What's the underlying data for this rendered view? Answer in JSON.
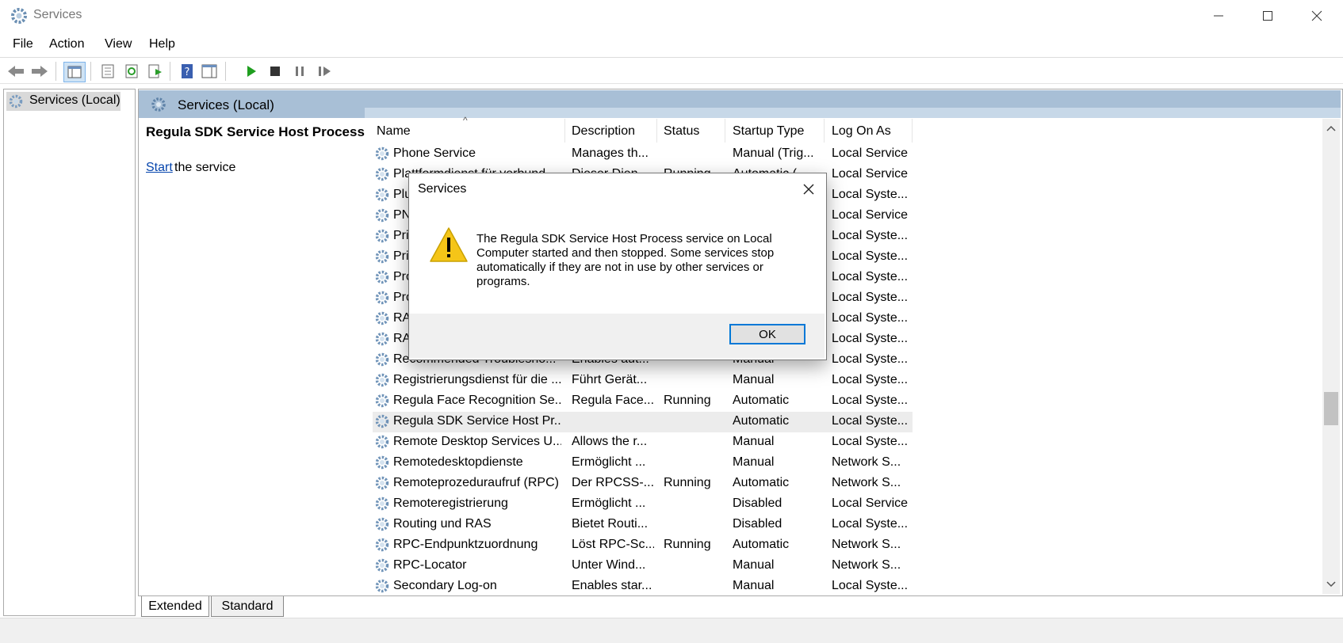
{
  "window": {
    "title": "Services"
  },
  "menu": [
    "File",
    "Action",
    "View",
    "Help"
  ],
  "tree": {
    "root": "Services (Local)"
  },
  "panel": {
    "header": "Services (Local)",
    "selected_service": "Regula SDK Service Host Process",
    "start_link": "Start",
    "start_rest": "the service"
  },
  "columns": {
    "name": "Name",
    "description": "Description",
    "status": "Status",
    "startup": "Startup Type",
    "logon": "Log On As"
  },
  "sort_indicator": "^",
  "rows": [
    {
      "name": "Phone Service",
      "desc": "Manages th...",
      "status": "",
      "startup": "Manual (Trig...",
      "logon": "Local Service"
    },
    {
      "name": "Plattformdienst für verbund...",
      "desc": "Dieser Dien...",
      "status": "Running",
      "startup": "Automatic (...",
      "logon": "Local Service"
    },
    {
      "name": "Plug and Play",
      "desc": "",
      "status": "",
      "startup": "",
      "logon": "Local Syste..."
    },
    {
      "name": "PNRP",
      "desc": "",
      "status": "",
      "startup": "",
      "logon": "Local Service"
    },
    {
      "name": "Print",
      "desc": "",
      "status": "",
      "startup": "",
      "logon": "Local Syste..."
    },
    {
      "name": "Print",
      "desc": "",
      "status": "",
      "startup": "",
      "logon": "Local Syste..."
    },
    {
      "name": "Prog",
      "desc": "",
      "status": "",
      "startup": "",
      "logon": "Local Syste..."
    },
    {
      "name": "Prog",
      "desc": "",
      "status": "",
      "startup": "",
      "logon": "Local Syste..."
    },
    {
      "name": "RAS",
      "desc": "",
      "status": "",
      "startup": "",
      "logon": "Local Syste..."
    },
    {
      "name": "RAS",
      "desc": "",
      "status": "",
      "startup": "",
      "logon": "Local Syste..."
    },
    {
      "name": "Recommended Troublesho...",
      "desc": "Enables aut...",
      "status": "",
      "startup": "Manual",
      "logon": "Local Syste..."
    },
    {
      "name": "Registrierungsdienst für die ...",
      "desc": "Führt Gerät...",
      "status": "",
      "startup": "Manual",
      "logon": "Local Syste..."
    },
    {
      "name": "Regula Face Recognition Se...",
      "desc": "Regula Face...",
      "status": "Running",
      "startup": "Automatic",
      "logon": "Local Syste..."
    },
    {
      "name": "Regula SDK Service Host Pr...",
      "desc": "",
      "status": "",
      "startup": "Automatic",
      "logon": "Local Syste..."
    },
    {
      "name": "Remote Desktop Services U...",
      "desc": "Allows the r...",
      "status": "",
      "startup": "Manual",
      "logon": "Local Syste..."
    },
    {
      "name": "Remotedesktopdienste",
      "desc": "Ermöglicht ...",
      "status": "",
      "startup": "Manual",
      "logon": "Network S..."
    },
    {
      "name": "Remoteprozeduraufruf (RPC)",
      "desc": "Der RPCSS-...",
      "status": "Running",
      "startup": "Automatic",
      "logon": "Network S..."
    },
    {
      "name": "Remoteregistrierung",
      "desc": "Ermöglicht ...",
      "status": "",
      "startup": "Disabled",
      "logon": "Local Service"
    },
    {
      "name": "Routing und RAS",
      "desc": "Bietet Routi...",
      "status": "",
      "startup": "Disabled",
      "logon": "Local Syste..."
    },
    {
      "name": "RPC-Endpunktzuordnung",
      "desc": "Löst RPC-Sc...",
      "status": "Running",
      "startup": "Automatic",
      "logon": "Network S..."
    },
    {
      "name": "RPC-Locator",
      "desc": "Unter Wind...",
      "status": "",
      "startup": "Manual",
      "logon": "Network S..."
    },
    {
      "name": "Secondary Log-on",
      "desc": "Enables star...",
      "status": "",
      "startup": "Manual",
      "logon": "Local Syste..."
    }
  ],
  "tabs": {
    "extended": "Extended",
    "standard": "Standard"
  },
  "dialog": {
    "title": "Services",
    "message": "The Regula SDK Service Host Process service on Local Computer started and then stopped. Some services stop automatically if they are not in use by other services or programs.",
    "ok": "OK"
  },
  "colors": {
    "header_band": "#a8bfd6",
    "accent": "#0078d7",
    "warning": "#f5c518",
    "link": "#0645ad"
  }
}
